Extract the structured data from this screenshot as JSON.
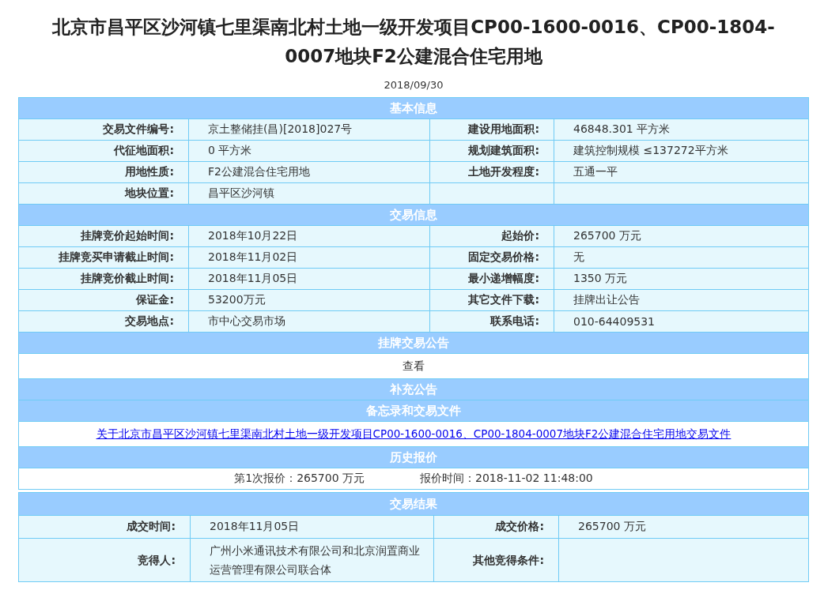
{
  "title": "北京市昌平区沙河镇七里渠南北村土地一级开发项目CP00-1600-0016、CP00-1804-0007地块F2公建混合住宅用地",
  "date": "2018/09/30",
  "sections": [
    {
      "kind": "fields",
      "heading": "基本信息",
      "rows": [
        {
          "cells": [
            {
              "label": "交易文件编号:",
              "value": "京土整储挂(昌)[2018]027号"
            },
            {
              "label": "建设用地面积:",
              "value": "46848.301 平方米"
            }
          ]
        },
        {
          "cells": [
            {
              "label": "代征地面积:",
              "value": "0 平方米"
            },
            {
              "label": "规划建筑面积:",
              "value": "建筑控制规模 ≤137272平方米"
            }
          ]
        },
        {
          "cells": [
            {
              "label": "用地性质:",
              "value": "F2公建混合住宅用地"
            },
            {
              "label": "土地开发程度:",
              "value": "五通一平"
            }
          ]
        },
        {
          "cells": [
            {
              "label": "地块位置:",
              "value": "昌平区沙河镇"
            }
          ]
        }
      ]
    },
    {
      "kind": "fields",
      "heading": "交易信息",
      "rows": [
        {
          "cells": [
            {
              "label": "挂牌竞价起始时间:",
              "value": "2018年10月22日"
            },
            {
              "label": "起始价:",
              "value": "265700 万元"
            }
          ]
        },
        {
          "cells": [
            {
              "label": "挂牌竞买申请截止时间:",
              "value": "2018年11月02日"
            },
            {
              "label": "固定交易价格:",
              "value": "无"
            }
          ]
        },
        {
          "cells": [
            {
              "label": "挂牌竞价截止时间:",
              "value": "2018年11月05日"
            },
            {
              "label": "最小递增幅度:",
              "value": "1350 万元"
            }
          ]
        },
        {
          "cells": [
            {
              "label": "保证金:",
              "value": "53200万元"
            },
            {
              "label": "其它文件下载:",
              "value": "挂牌出让公告"
            }
          ]
        },
        {
          "cells": [
            {
              "label": "交易地点:",
              "value": "市中心交易市场"
            },
            {
              "label": "联系电话:",
              "value": "010-64409531"
            }
          ]
        }
      ]
    },
    {
      "kind": "text",
      "heading": "挂牌交易公告",
      "text": "查看"
    },
    {
      "kind": "empty",
      "heading": "补充公告"
    },
    {
      "kind": "link",
      "heading": "备忘录和交易文件",
      "text": "关于北京市昌平区沙河镇七里渠南北村土地一级开发项目CP00-1600-0016、CP00-1804-0007地块F2公建混合住宅用地交易文件"
    },
    {
      "kind": "bids",
      "heading": "历史报价",
      "bids": [
        {
          "price": "第1次报价：265700 万元",
          "time": "报价时间：2018-11-02 11:48:00"
        }
      ]
    }
  ],
  "result": {
    "heading": "交易结果",
    "rows": [
      {
        "cells": [
          {
            "label": "成交时间:",
            "value": "2018年11月05日"
          },
          {
            "label": "成交价格:",
            "value": "265700 万元"
          }
        ]
      },
      {
        "cells": [
          {
            "label": "竞得人:",
            "value": "广州小米通讯技术有限公司和北京润置商业运营管理有限公司联合体"
          },
          {
            "label": "其他竞得条件:"
          }
        ]
      }
    ]
  }
}
